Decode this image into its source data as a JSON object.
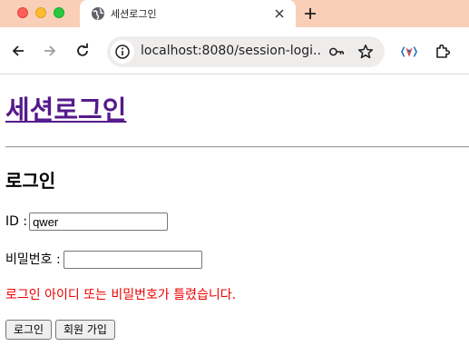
{
  "browser": {
    "tab_title": "세션로그인",
    "url": "localhost:8080/session-logi...",
    "colors": {
      "tabstrip": "#f9cfb8",
      "close": "#fe5f57",
      "minimize": "#febc2e",
      "zoom": "#28c840"
    }
  },
  "page": {
    "heading": "세션로그인",
    "subheading": "로그인",
    "id_label": "ID :",
    "id_value": "qwer",
    "password_label": "비밀번호 :",
    "password_value": "",
    "error_message": "로그인 아이디 또는 비밀번호가 틀렸습니다.",
    "login_button": "로그인",
    "signup_button": "회원 가입",
    "colors": {
      "heading_link": "#551a8b",
      "error": "#ee0000"
    }
  }
}
